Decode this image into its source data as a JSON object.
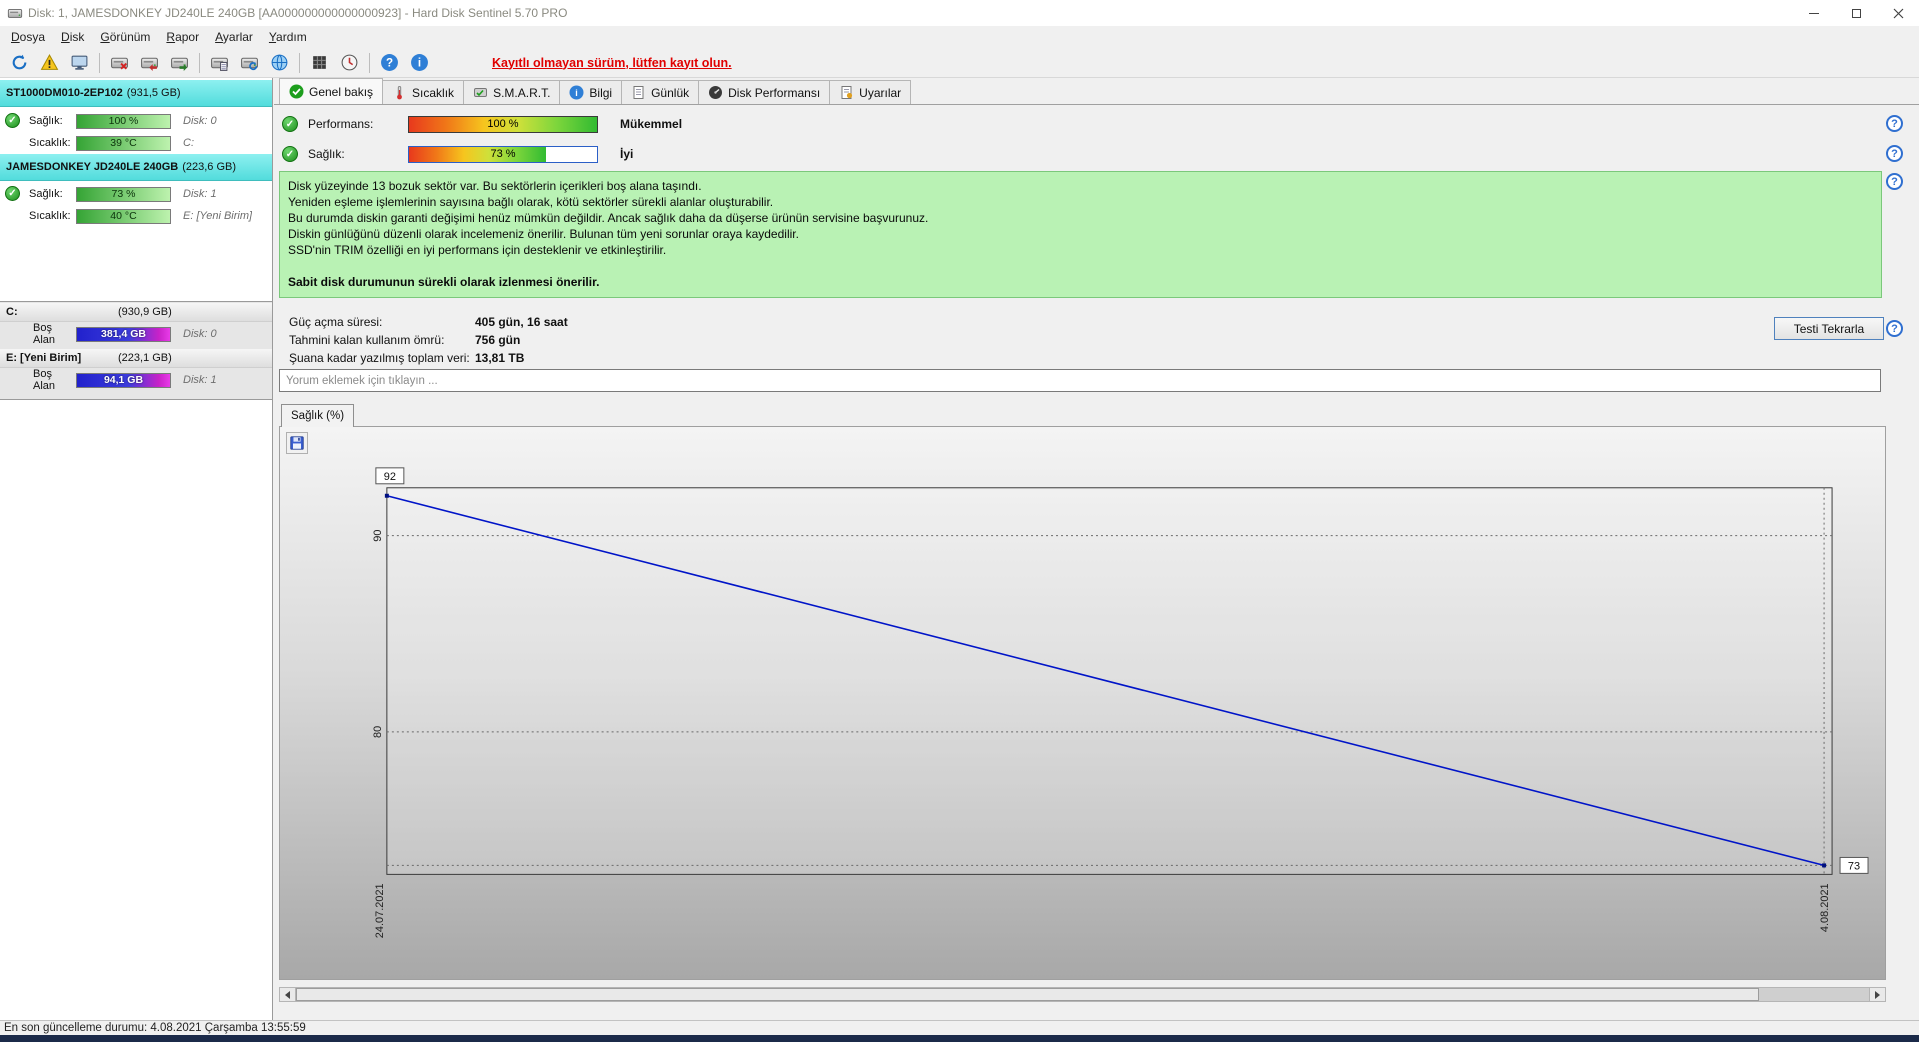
{
  "window": {
    "title": "Disk: 1, JAMESDONKEY JD240LE 240GB [AA000000000000000923]  -  Hard Disk Sentinel 5.70 PRO"
  },
  "menu": {
    "items": [
      {
        "label": "Dosya"
      },
      {
        "label": "Disk"
      },
      {
        "label": "Görünüm"
      },
      {
        "label": "Rapor"
      },
      {
        "label": "Ayarlar"
      },
      {
        "label": "Yardım"
      }
    ]
  },
  "toolbar": {
    "register_link": "Kayıtlı olmayan sürüm, lütfen kayıt olun.",
    "icons": [
      "refresh-icon",
      "alerts-icon",
      "monitor-icon",
      "disk-remove-icon",
      "disk-prev-icon",
      "disk-next-icon",
      "disk-report-icon",
      "disk-sync-icon",
      "world-icon",
      "surface-test-icon",
      "scheduler-icon",
      "help-icon",
      "info-icon"
    ]
  },
  "sidebar": {
    "disks": [
      {
        "name": "ST1000DM010-2EP102",
        "size": "(931,5 GB)",
        "health_label": "Sağlık:",
        "health": "100 %",
        "disk": "Disk: 0",
        "temp_label": "Sıcaklık:",
        "temp": "39 °C",
        "drive": "C:"
      },
      {
        "name": "JAMESDONKEY JD240LE 240GB",
        "size": "(223,6 GB)",
        "health_label": "Sağlık:",
        "health": "73 %",
        "disk": "Disk: 1",
        "temp_label": "Sıcaklık:",
        "temp": "40 °C",
        "drive": "E: [Yeni Birim]"
      }
    ],
    "partitions": [
      {
        "drive": "C:",
        "size": "(930,9 GB)",
        "free_label": "Boş Alan",
        "free": "381,4 GB",
        "disk": "Disk: 0"
      },
      {
        "drive": "E: [Yeni Birim]",
        "size": "(223,1 GB)",
        "free_label": "Boş Alan",
        "free": "94,1 GB",
        "disk": "Disk: 1"
      }
    ]
  },
  "tabs": [
    {
      "label": "Genel bakış"
    },
    {
      "label": "Sıcaklık"
    },
    {
      "label": "S.M.A.R.T."
    },
    {
      "label": "Bilgi"
    },
    {
      "label": "Günlük"
    },
    {
      "label": "Disk Performansı"
    },
    {
      "label": "Uyarılar"
    }
  ],
  "overview": {
    "performance": {
      "label": "Performans:",
      "value": "100 %",
      "rating": "Mükemmel",
      "percent": 100
    },
    "health": {
      "label": "Sağlık:",
      "value": "73 %",
      "rating": "İyi",
      "percent": 73
    },
    "message": {
      "lines": [
        "Disk yüzeyinde 13 bozuk sektör var. Bu sektörlerin içerikleri boş alana taşındı.",
        "Yeniden eşleme işlemlerinin sayısına bağlı olarak, kötü sektörler sürekli alanlar oluşturabilir.",
        "Bu durumda diskin garanti değişimi henüz mümkün değildir. Ancak sağlık daha da düşerse ürünün servisine başvurunuz.",
        "Diskin günlüğünü düzenli olarak incelemeniz önerilir. Bulunan tüm yeni sorunlar oraya kaydedilir.",
        "SSD'nin TRIM özelliği en iyi performans için desteklenir ve etkinleştirilir."
      ],
      "emphasis": "Sabit disk durumunun sürekli olarak izlenmesi önerilir."
    },
    "stats": [
      {
        "label": "Güç açma süresi:",
        "value": "405 gün, 16 saat"
      },
      {
        "label": "Tahmini kalan kullanım ömrü:",
        "value": "756 gün"
      },
      {
        "label": "Şuana kadar yazılmış toplam veri:",
        "value": "13,81 TB"
      }
    ],
    "retest_button": "Testi Tekrarla",
    "comment_placeholder": "Yorum eklemek için tıklayın ..."
  },
  "chart": {
    "tab_label": "Sağlık (%)",
    "type": "line",
    "series": [
      {
        "name": "Sağlık (%)",
        "points": [
          {
            "x": "24.07.2021",
            "y": 92
          },
          {
            "x": "4.08.2021",
            "y": 73
          }
        ]
      }
    ],
    "start_label": "92",
    "end_label": "73",
    "y_ticks": [
      "90",
      "80"
    ],
    "x_ticks": [
      "24.07.2021",
      "4.08.2021"
    ],
    "line_color": "#0014c8"
  },
  "statusbar": {
    "text": "En son güncelleme durumu: 4.08.2021 Çarşamba 13:55:59"
  }
}
